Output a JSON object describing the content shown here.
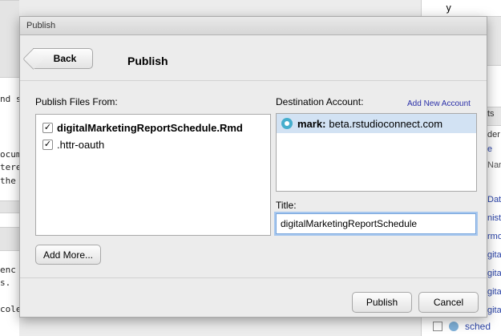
{
  "background": {
    "code_lines": [
      "nd s",
      "",
      "",
      "ocume",
      "tere",
      "the"
    ],
    "code_lines_lower": [
      "enc",
      "s."
    ],
    "code_line_bottom": "cole",
    "right_pane": {
      "var": "y",
      "tab_fragment": "ts",
      "header_fragment": "der",
      "col_fragment": "Nar",
      "link_fragment": "e",
      "files": [
        "Dat",
        "nist",
        "rmo",
        "gita",
        "gita",
        "gita",
        "gita"
      ],
      "bottom_file": "sched"
    }
  },
  "dialog": {
    "window_title": "Publish",
    "header": {
      "back_label": "Back",
      "title": "Publish"
    },
    "files": {
      "label": "Publish Files From:",
      "items": [
        {
          "name": "digitalMarketingReportSchedule.Rmd",
          "checked": true,
          "bold": true
        },
        {
          "name": ".httr-oauth",
          "checked": true,
          "bold": false
        }
      ],
      "add_more_label": "Add More..."
    },
    "destination": {
      "label": "Destination Account:",
      "add_new_label": "Add New Account",
      "accounts": [
        {
          "user": "mark:",
          "server": "beta.rstudioconnect.com",
          "selected": true
        }
      ]
    },
    "title_field": {
      "label": "Title:",
      "value": "digitalMarketingReportSchedule"
    },
    "footer": {
      "publish_label": "Publish",
      "cancel_label": "Cancel"
    }
  }
}
